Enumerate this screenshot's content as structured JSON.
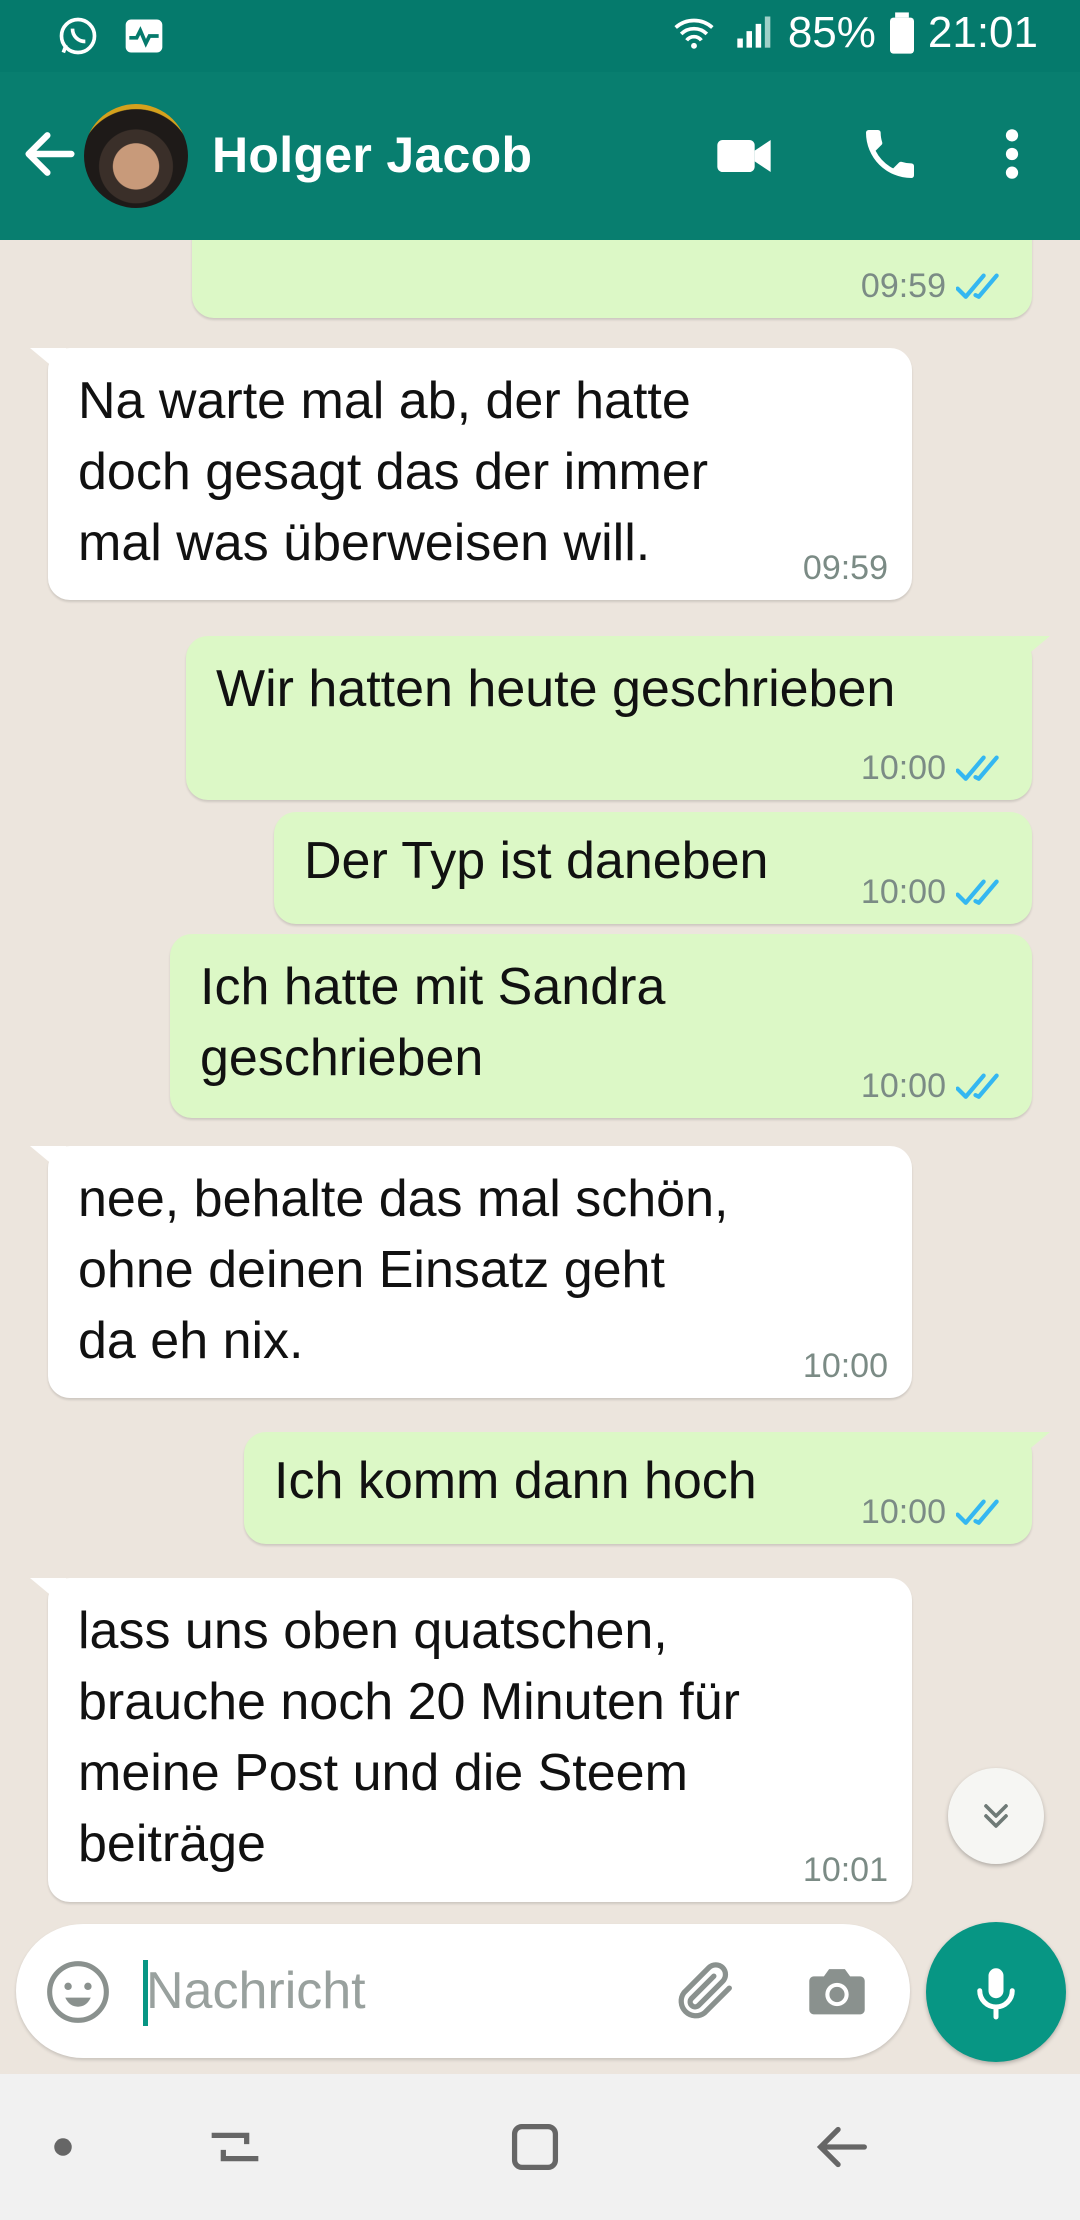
{
  "status_bar": {
    "battery": "85%",
    "time": "21:01",
    "icons": [
      "whatsapp-icon",
      "pulse-icon",
      "wifi-icon",
      "signal-icon",
      "battery-icon"
    ]
  },
  "header": {
    "contact_name": "Holger Jacob",
    "icons": [
      "back-arrow-icon",
      "video-call-icon",
      "phone-icon",
      "more-vert-icon"
    ]
  },
  "messages": [
    {
      "direction": "out",
      "text": "",
      "time": "09:59",
      "read": true
    },
    {
      "direction": "in",
      "text": "Na warte mal ab, der hatte\ndoch gesagt das der immer\nmal was überweisen will.",
      "time": "09:59"
    },
    {
      "direction": "out",
      "text": "Wir hatten heute geschrieben",
      "time": "10:00",
      "read": true
    },
    {
      "direction": "out",
      "text": "Der Typ ist daneben",
      "time": "10:00",
      "read": true
    },
    {
      "direction": "out",
      "text": "Ich hatte mit Sandra\ngeschrieben",
      "time": "10:00",
      "read": true
    },
    {
      "direction": "in",
      "text": "nee, behalte das mal schön,\nohne deinen Einsatz geht\nda eh nix.",
      "time": "10:00"
    },
    {
      "direction": "out",
      "text": "Ich komm dann hoch",
      "time": "10:00",
      "read": true
    },
    {
      "direction": "in",
      "text": "lass uns oben quatschen,\nbrauche noch 20 Minuten für\nmeine Post und die Steem\nbeiträge",
      "time": "10:01"
    }
  ],
  "composer": {
    "placeholder": "Nachricht",
    "value": "",
    "icons": [
      "emoji-icon",
      "paperclip-icon",
      "camera-icon",
      "microphone-icon"
    ]
  },
  "colors": {
    "header": "#087e6f",
    "status_bar": "#057a6c",
    "outgoing_bubble": "#dcf8c6",
    "incoming_bubble": "#ffffff",
    "chat_background": "#ece5dd",
    "accent": "#079684",
    "read_tick": "#34b7f1"
  }
}
